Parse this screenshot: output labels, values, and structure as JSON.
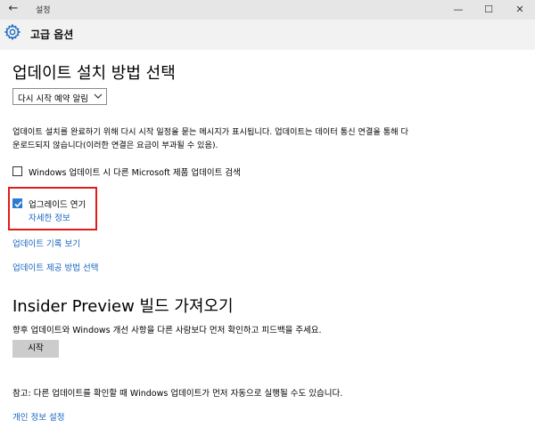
{
  "window": {
    "title": "설정",
    "back_glyph": "←",
    "minimize_glyph": "—",
    "maximize_glyph": "☐",
    "close_glyph": "✕"
  },
  "header": {
    "title": "고급 옵션",
    "icon": "gear-icon"
  },
  "install_section": {
    "heading": "업데이트 설치 방법 선택",
    "dropdown_value": "다시 시작 예약 알림",
    "description_line1": "업데이트 설치를 완료하기 위해 다시 시작 일정을 묻는 메시지가 표시됩니다. 업데이트는 데이터 통신 연결을 통해 다",
    "description_line2": "운로드되지 않습니다(이러한 연결은 요금이 부과될 수 있음).",
    "microsoft_updates_checkbox": {
      "label": "Windows 업데이트 시 다른 Microsoft 제품 업데이트 검색",
      "checked": false
    },
    "defer_upgrades_checkbox": {
      "label": "업그레이드 연기",
      "checked": true
    },
    "more_info_link": "자세한 정보",
    "history_link": "업데이트 기록 보기",
    "delivery_link": "업데이트 제공 방법 선택"
  },
  "insider_section": {
    "heading": "Insider Preview 빌드 가져오기",
    "description": "향후 업데이트와 Windows 개선 사항을 다른 사람보다 먼저 확인하고 피드백을 주세요.",
    "start_button": "시작"
  },
  "footer": {
    "note": "참고: 다른 업데이트를 확인할 때 Windows 업데이트가 먼저 자동으로 실행될 수도 있습니다.",
    "privacy_link": "개인 정보 설정"
  },
  "colors": {
    "accent": "#1665c1",
    "checkbox": "#2b7bd3",
    "highlight": "#e31b1b"
  }
}
